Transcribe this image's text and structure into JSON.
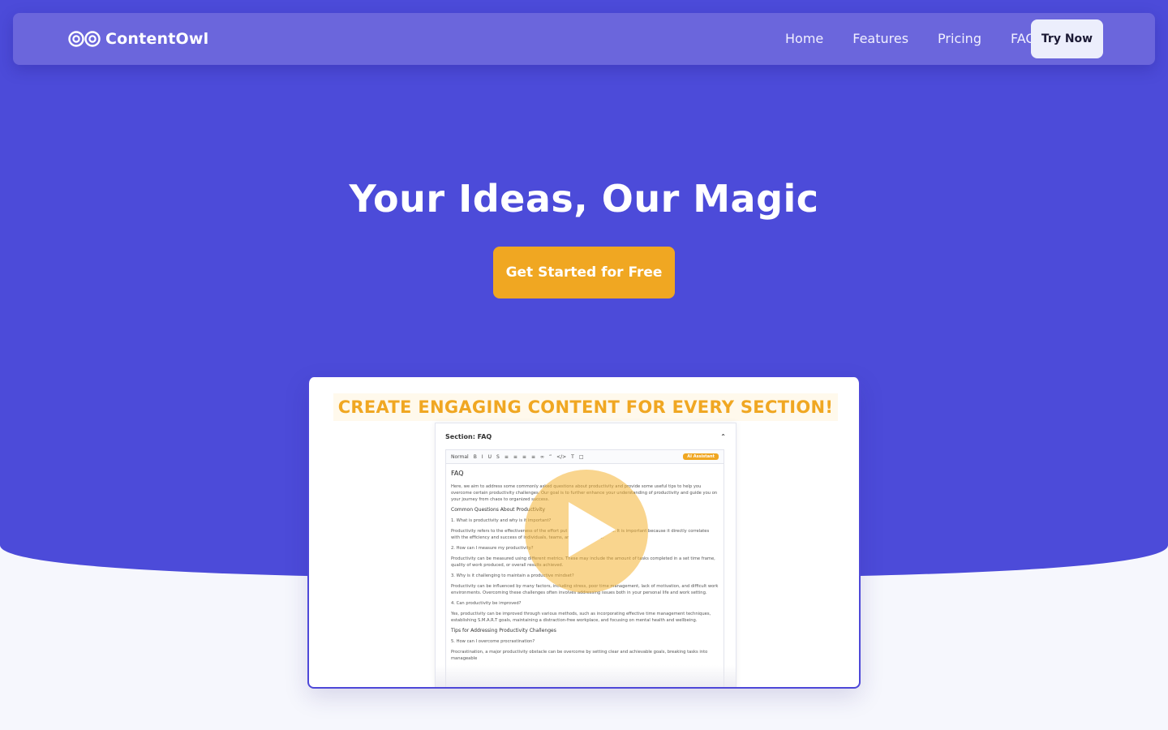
{
  "colors": {
    "hero_bg": "#4c4bd9",
    "navbar_bg": "#6b66dc",
    "accent": "#f0a722",
    "page_bg": "#f6f7fd"
  },
  "brand": {
    "name": "ContentOwl",
    "logo_icon": "owl-eyes-icon"
  },
  "nav": {
    "links": [
      "Home",
      "Features",
      "Pricing",
      "FAQ"
    ],
    "cta": "Try Now"
  },
  "hero": {
    "headline": "Your Ideas, Our Magic",
    "cta": "Get Started for Free"
  },
  "video": {
    "banner": "CREATE ENGAGING CONTENT FOR EVERY SECTION!",
    "play_icon": "play-icon",
    "doc": {
      "section_title": "Section: FAQ",
      "collapse_icon": "chevron-up-icon",
      "toolbar_format": "Normal",
      "toolbar_icons": [
        "bold-icon",
        "italic-icon",
        "underline-icon",
        "strike-icon",
        "align-icon",
        "list-icon",
        "list-ordered-icon",
        "indent-icon",
        "outdent-icon",
        "link-icon",
        "quote-icon",
        "code-icon",
        "clear-format-icon",
        "fullscreen-icon"
      ],
      "ai_button": "AI Assistant",
      "title": "FAQ",
      "lines": [
        {
          "kind": "text",
          "text": "Here, we aim to address some commonly asked questions about productivity and provide some useful tips to help you overcome certain productivity challenges. Our goal is to further enhance your understanding of productivity and guide you on your journey from chaos to organized success."
        },
        {
          "kind": "head",
          "text": "Common Questions About Productivity"
        },
        {
          "kind": "text",
          "text": "1. What is productivity and why is it important?"
        },
        {
          "kind": "text",
          "text": "Productivity refers to the effectiveness of the effort put into producing output. It is important because it directly correlates with the efficiency and success of individuals, teams, and organizations."
        },
        {
          "kind": "text",
          "text": "2. How can I measure my productivity?"
        },
        {
          "kind": "text",
          "text": "Productivity can be measured using different metrics. These may include the amount of tasks completed in a set time frame, quality of work produced, or overall results achieved."
        },
        {
          "kind": "text",
          "text": "3. Why is it challenging to maintain a productive mindset?"
        },
        {
          "kind": "text",
          "text": "Productivity can be influenced by many factors, including stress, poor time management, lack of motivation, and difficult work environments. Overcoming these challenges often involves addressing issues both in your personal life and work setting."
        },
        {
          "kind": "text",
          "text": "4. Can productivity be improved?"
        },
        {
          "kind": "text",
          "text": "Yes, productivity can be improved through various methods, such as incorporating effective time management techniques, establishing S.M.A.R.T goals, maintaining a distraction-free workplace, and focusing on mental health and wellbeing."
        },
        {
          "kind": "head",
          "text": "Tips for Addressing Productivity Challenges"
        },
        {
          "kind": "text",
          "text": "5. How can I overcome procrastination?"
        },
        {
          "kind": "text",
          "text": "Procrastination, a major productivity obstacle can be overcome by setting clear and achievable goals, breaking tasks into manageable"
        }
      ]
    }
  }
}
